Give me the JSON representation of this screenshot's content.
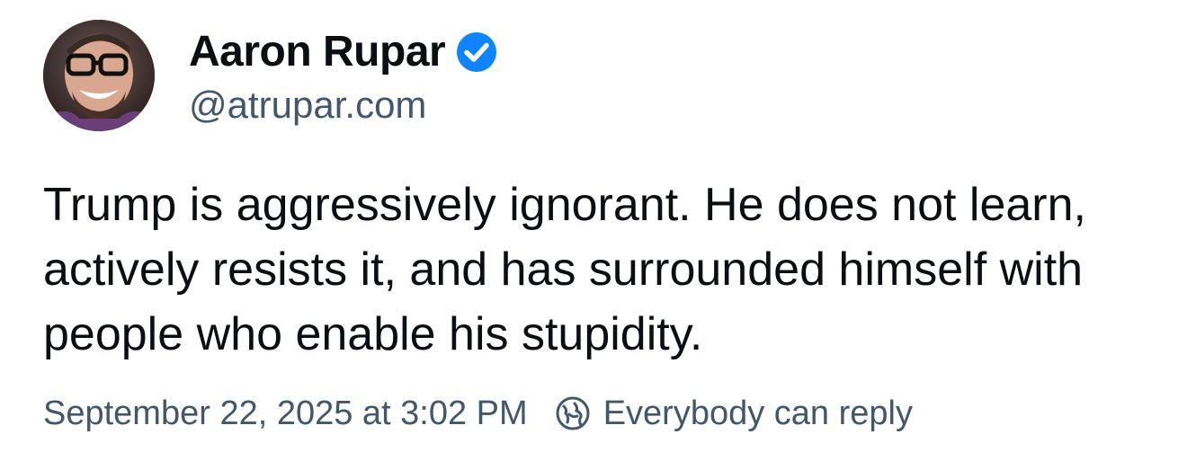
{
  "author": {
    "display_name": "Aaron Rupar",
    "handle": "@atrupar.com",
    "verified": true,
    "avatar_icon": "avatar-photo"
  },
  "post": {
    "text": "Trump is aggressively ignorant. He does not learn, actively resists it, and has surrounded himself with people who enable his stupidity.",
    "timestamp": "September 22, 2025 at 3:02 PM",
    "reply_setting": "Everybody can reply",
    "reply_icon": "globe-reply-icon"
  },
  "colors": {
    "text": "#0b0f14",
    "muted": "#42576c",
    "verified": "#1083fe"
  }
}
